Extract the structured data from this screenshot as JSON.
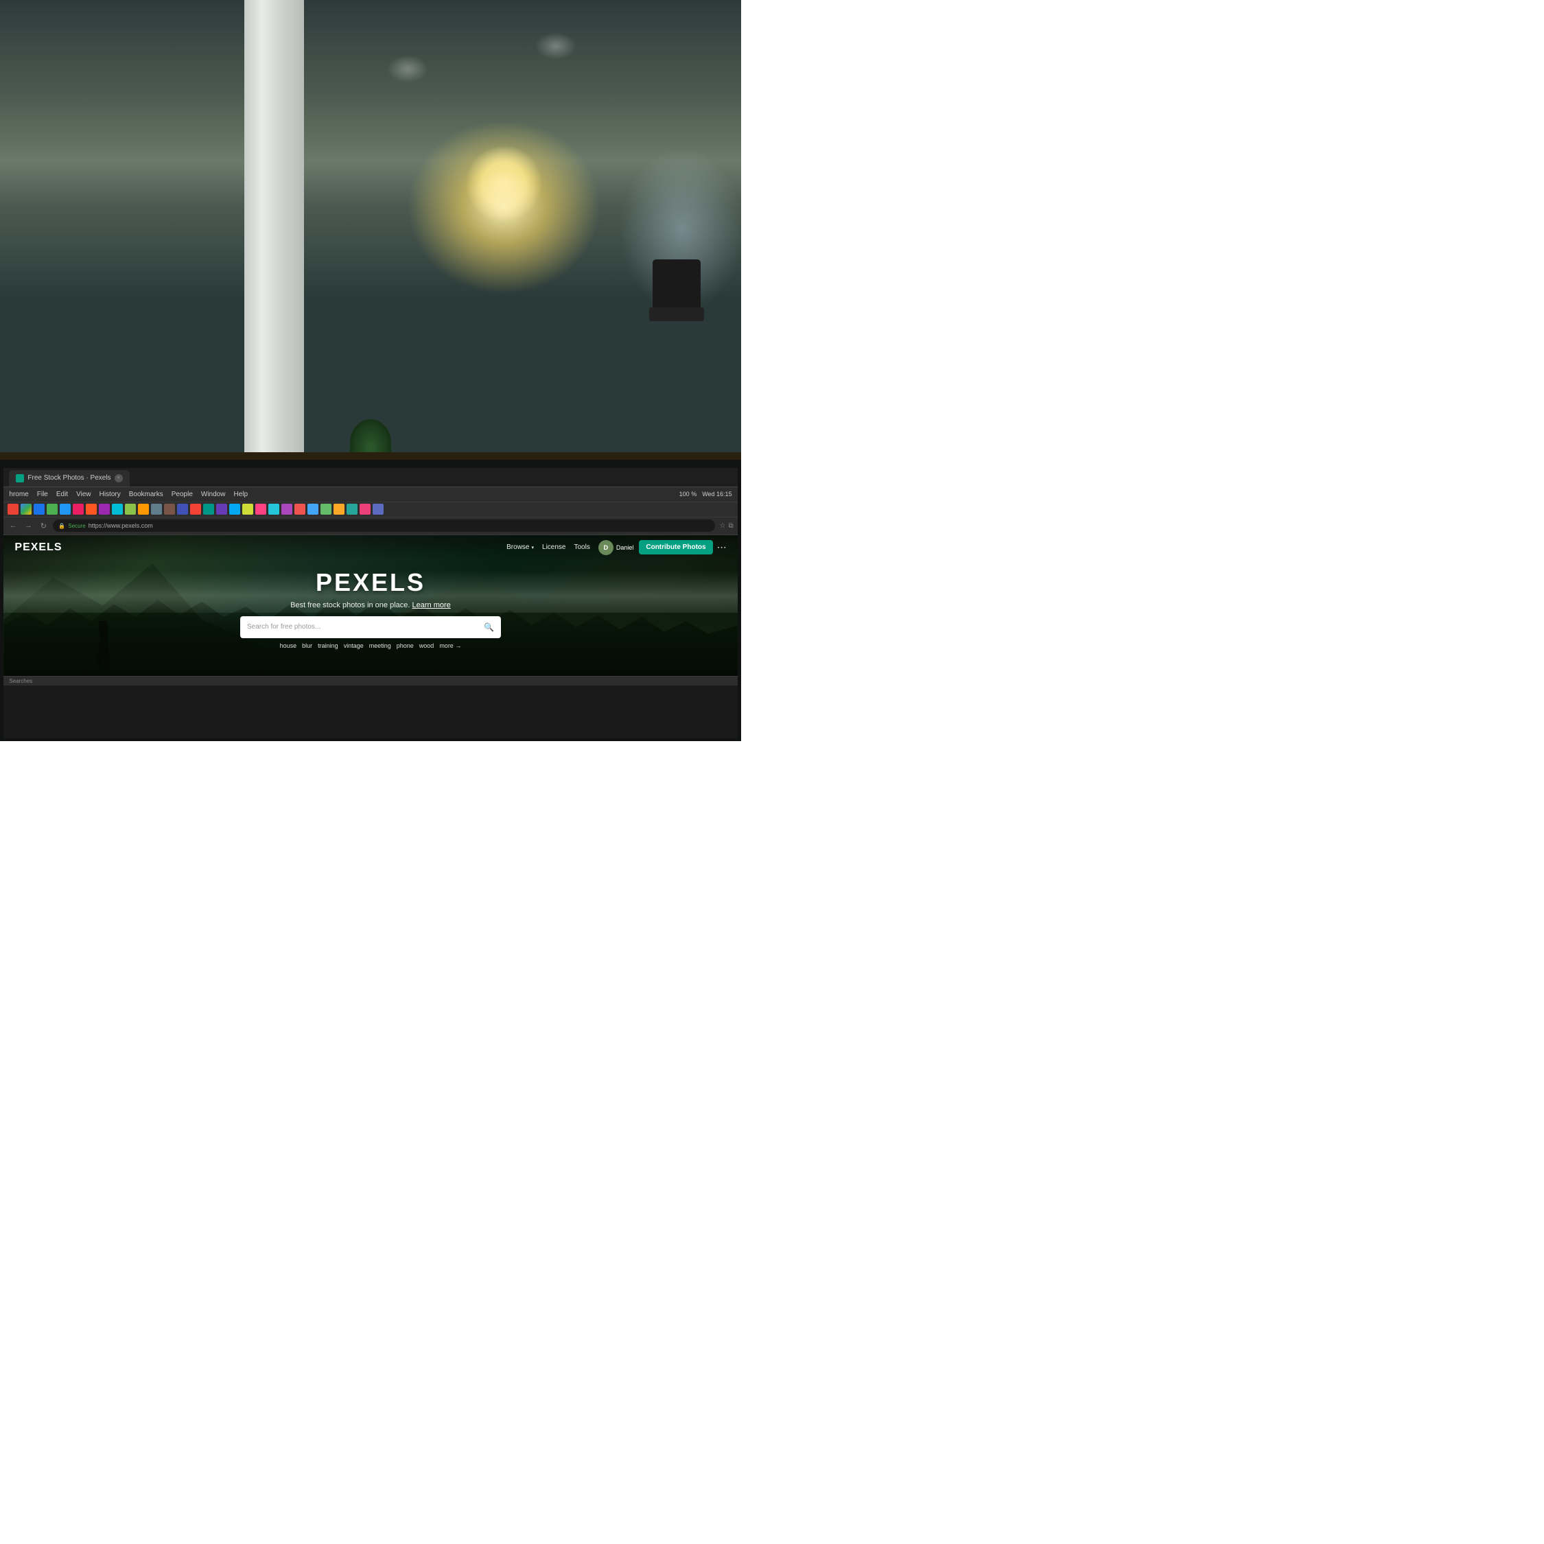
{
  "scene": {
    "type": "office_background_with_monitor"
  },
  "browser": {
    "tab": {
      "favicon_color": "#05a081",
      "title": "Free Stock Photos · Pexels"
    },
    "menubar": {
      "app_name": "hrome",
      "items": [
        "File",
        "Edit",
        "View",
        "History",
        "Bookmarks",
        "People",
        "Window",
        "Help"
      ]
    },
    "addressbar": {
      "secure_text": "Secure",
      "url": "https://www.pexels.com"
    },
    "system": {
      "time": "Wed 16:15",
      "battery": "100 %"
    },
    "statusbar": {
      "text": "Searches"
    }
  },
  "pexels": {
    "nav": {
      "browse_label": "Browse",
      "license_label": "License",
      "tools_label": "Tools",
      "user_name": "Daniel",
      "contribute_label": "Contribute Photos"
    },
    "hero": {
      "title": "PEXELS",
      "tagline": "Best free stock photos in one place.",
      "tagline_link": "Learn more"
    },
    "search": {
      "placeholder": "Search for free photos..."
    },
    "quick_tags": [
      "house",
      "blur",
      "training",
      "vintage",
      "meeting",
      "phone",
      "wood"
    ],
    "more_label": "more →"
  }
}
